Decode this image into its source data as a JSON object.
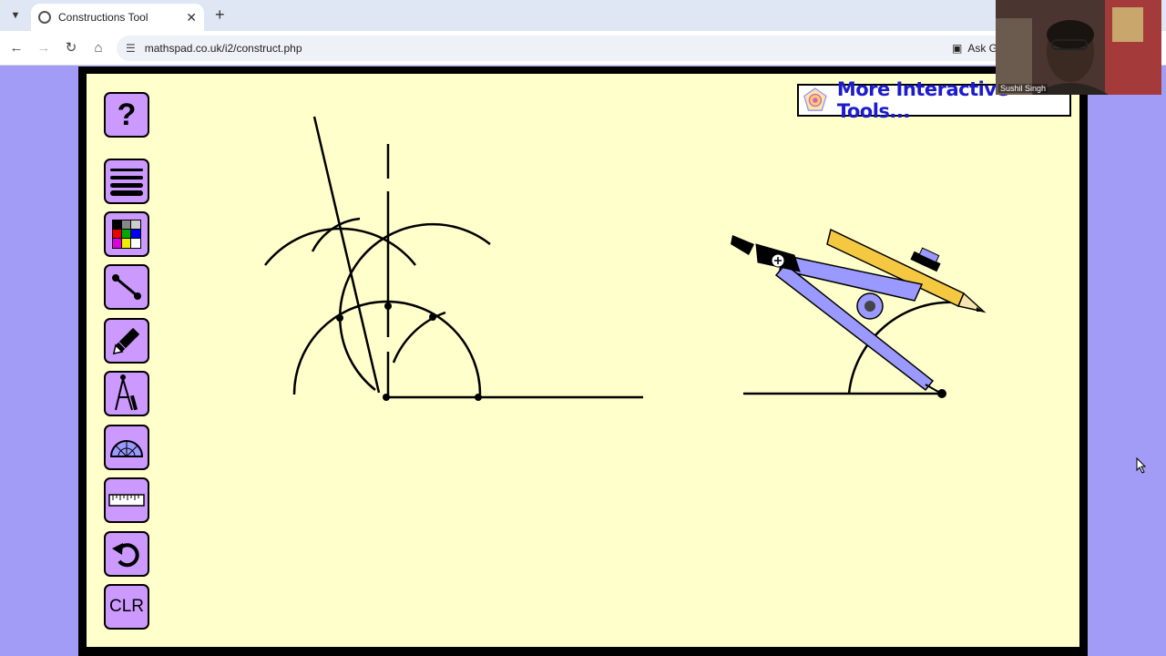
{
  "browser": {
    "tab_title": "Constructions Tool",
    "new_tab_symbol": "+",
    "url": "mathspad.co.uk/i2/construct.php",
    "ask_label": "Ask Ge"
  },
  "app": {
    "help_label": "?",
    "clear_label": "CLR",
    "banner_text": "More Interactive Tools...",
    "tools": [
      {
        "name": "line-weight-tool",
        "icon": "lines-icon"
      },
      {
        "name": "colour-palette-tool",
        "icon": "palette-icon"
      },
      {
        "name": "line-segment-tool",
        "icon": "segment-icon"
      },
      {
        "name": "pencil-tool",
        "icon": "pencil-icon"
      },
      {
        "name": "compass-tool",
        "icon": "compass-icon"
      },
      {
        "name": "protractor-tool",
        "icon": "protractor-icon"
      },
      {
        "name": "ruler-tool",
        "icon": "ruler-icon"
      },
      {
        "name": "undo-tool",
        "icon": "undo-icon"
      }
    ]
  },
  "webcam": {
    "participant_name": "Sushil Singh"
  },
  "colors": {
    "page_bg": "#a39cf7",
    "canvas_bg": "#ffffcc",
    "tool_button": "#cc99ff",
    "banner_text": "#1c1ccc",
    "compass_body": "#9999ff",
    "pencil": "#f5c842"
  }
}
